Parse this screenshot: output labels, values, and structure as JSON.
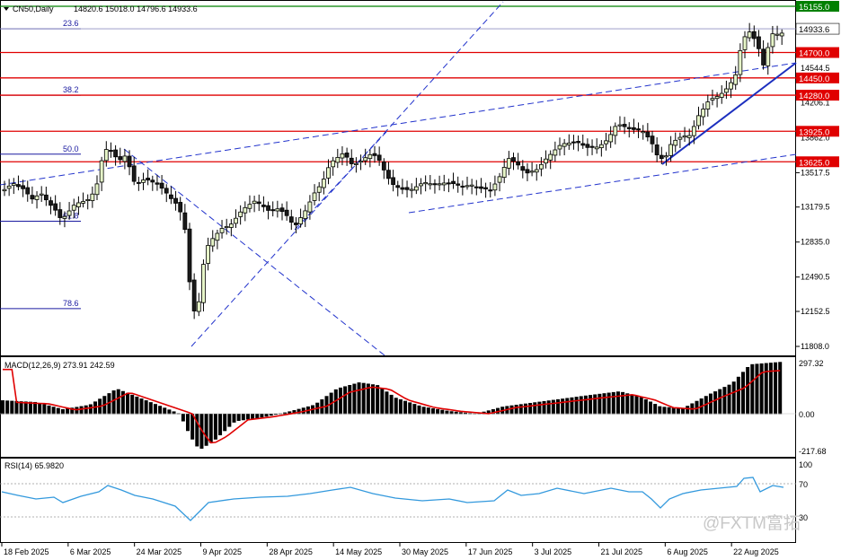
{
  "header": {
    "symbol_label": "CN50,Daily",
    "ohlc": "14820.6 15018.0 14796.6 14933.6"
  },
  "price_panel": {
    "y_ticks": [
      "13517.5",
      "13179.5",
      "12835.0",
      "12490.5",
      "12152.5",
      "11808.0"
    ],
    "levels": [
      {
        "label": "15155.0",
        "value": 15155.0,
        "color": "#008000"
      },
      {
        "label": "14700.0",
        "value": 14700.0,
        "color": "#e00000"
      },
      {
        "label": "14450.0",
        "value": 14450.0,
        "color": "#e00000"
      },
      {
        "label": "14280.0",
        "value": 14280.0,
        "color": "#e00000"
      },
      {
        "label": "13925.0",
        "value": 13925.0,
        "color": "#e00000"
      },
      {
        "label": "13625.0",
        "value": 13625.0,
        "color": "#e00000"
      }
    ],
    "last_price": {
      "label": "14933.6",
      "value": 14933.6
    },
    "fib_levels": [
      {
        "label": "23.6",
        "value": 14933.6
      },
      {
        "label": "38.2",
        "value": 14280.0
      },
      {
        "label": "50.0",
        "value": 13700.0
      },
      {
        "label": "61.8",
        "value": 13040.0
      },
      {
        "label": "78.6",
        "value": 12180.0
      }
    ],
    "partial_ticks": [
      "14544.5",
      "14206.1",
      "13862.0"
    ]
  },
  "macd_panel": {
    "label": "MACD(12,26,9) 273.91 242.59",
    "y_ticks": [
      "297.32",
      "0.00",
      "-217.68"
    ],
    "signal_color": "#e00000"
  },
  "rsi_panel": {
    "label": "RSI(14) 65.9820",
    "y_ticks": [
      "100",
      "70",
      "30"
    ],
    "line_color": "#3399dd"
  },
  "x_axis": {
    "labels": [
      "18 Feb 2025",
      "6 Mar 2025",
      "24 Mar 2025",
      "9 Apr 2025",
      "28 Apr 2025",
      "14 May 2025",
      "30 May 2025",
      "17 Jun 2025",
      "3 Jul 2025",
      "21 Jul 2025",
      "6 Aug 2025",
      "22 Aug 2025"
    ]
  },
  "watermark": {
    "text": "@FXTM富拓"
  }
}
